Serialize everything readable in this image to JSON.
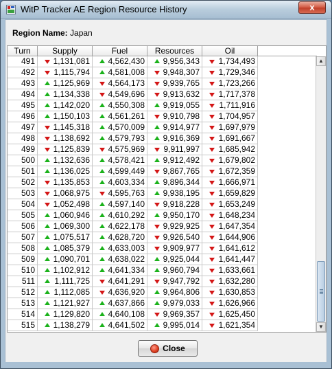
{
  "window": {
    "title": "WitP Tracker AE Region Resource History",
    "close_glyph": "x"
  },
  "region": {
    "label": "Region Name:",
    "value": "Japan"
  },
  "table": {
    "columns": [
      "Turn",
      "Supply",
      "Fuel",
      "Resources",
      "Oil"
    ],
    "rows": [
      {
        "turn": "491",
        "supply": "1,131,081",
        "supply_dir": "down",
        "fuel": "4,562,430",
        "fuel_dir": "up",
        "resources": "9,956,343",
        "resources_dir": "up",
        "oil": "1,734,493",
        "oil_dir": "down"
      },
      {
        "turn": "492",
        "supply": "1,115,794",
        "supply_dir": "down",
        "fuel": "4,581,008",
        "fuel_dir": "up",
        "resources": "9,948,307",
        "resources_dir": "down",
        "oil": "1,729,346",
        "oil_dir": "down"
      },
      {
        "turn": "493",
        "supply": "1,125,969",
        "supply_dir": "up",
        "fuel": "4,564,173",
        "fuel_dir": "down",
        "resources": "9,939,765",
        "resources_dir": "down",
        "oil": "1,723,266",
        "oil_dir": "down"
      },
      {
        "turn": "494",
        "supply": "1,134,338",
        "supply_dir": "up",
        "fuel": "4,549,696",
        "fuel_dir": "down",
        "resources": "9,913,632",
        "resources_dir": "down",
        "oil": "1,717,378",
        "oil_dir": "down"
      },
      {
        "turn": "495",
        "supply": "1,142,020",
        "supply_dir": "up",
        "fuel": "4,550,308",
        "fuel_dir": "up",
        "resources": "9,919,055",
        "resources_dir": "up",
        "oil": "1,711,916",
        "oil_dir": "down"
      },
      {
        "turn": "496",
        "supply": "1,150,103",
        "supply_dir": "up",
        "fuel": "4,561,261",
        "fuel_dir": "up",
        "resources": "9,910,798",
        "resources_dir": "down",
        "oil": "1,704,957",
        "oil_dir": "down"
      },
      {
        "turn": "497",
        "supply": "1,145,318",
        "supply_dir": "down",
        "fuel": "4,570,009",
        "fuel_dir": "up",
        "resources": "9,914,977",
        "resources_dir": "up",
        "oil": "1,697,979",
        "oil_dir": "down"
      },
      {
        "turn": "498",
        "supply": "1,138,692",
        "supply_dir": "down",
        "fuel": "4,579,793",
        "fuel_dir": "up",
        "resources": "9,916,369",
        "resources_dir": "up",
        "oil": "1,691,667",
        "oil_dir": "down"
      },
      {
        "turn": "499",
        "supply": "1,125,839",
        "supply_dir": "down",
        "fuel": "4,575,969",
        "fuel_dir": "down",
        "resources": "9,911,997",
        "resources_dir": "down",
        "oil": "1,685,942",
        "oil_dir": "down"
      },
      {
        "turn": "500",
        "supply": "1,132,636",
        "supply_dir": "up",
        "fuel": "4,578,421",
        "fuel_dir": "up",
        "resources": "9,912,492",
        "resources_dir": "up",
        "oil": "1,679,802",
        "oil_dir": "down"
      },
      {
        "turn": "501",
        "supply": "1,136,025",
        "supply_dir": "up",
        "fuel": "4,599,449",
        "fuel_dir": "up",
        "resources": "9,867,765",
        "resources_dir": "down",
        "oil": "1,672,359",
        "oil_dir": "down"
      },
      {
        "turn": "502",
        "supply": "1,135,853",
        "supply_dir": "down",
        "fuel": "4,603,334",
        "fuel_dir": "up",
        "resources": "9,896,344",
        "resources_dir": "up",
        "oil": "1,666,971",
        "oil_dir": "down"
      },
      {
        "turn": "503",
        "supply": "1,068,975",
        "supply_dir": "down",
        "fuel": "4,595,763",
        "fuel_dir": "down",
        "resources": "9,938,195",
        "resources_dir": "up",
        "oil": "1,659,829",
        "oil_dir": "down"
      },
      {
        "turn": "504",
        "supply": "1,052,498",
        "supply_dir": "down",
        "fuel": "4,597,140",
        "fuel_dir": "up",
        "resources": "9,918,228",
        "resources_dir": "down",
        "oil": "1,653,249",
        "oil_dir": "down"
      },
      {
        "turn": "505",
        "supply": "1,060,946",
        "supply_dir": "up",
        "fuel": "4,610,292",
        "fuel_dir": "up",
        "resources": "9,950,170",
        "resources_dir": "up",
        "oil": "1,648,234",
        "oil_dir": "down"
      },
      {
        "turn": "506",
        "supply": "1,069,300",
        "supply_dir": "up",
        "fuel": "4,622,178",
        "fuel_dir": "up",
        "resources": "9,929,925",
        "resources_dir": "down",
        "oil": "1,647,354",
        "oil_dir": "down"
      },
      {
        "turn": "507",
        "supply": "1,075,517",
        "supply_dir": "up",
        "fuel": "4,628,720",
        "fuel_dir": "up",
        "resources": "9,926,540",
        "resources_dir": "down",
        "oil": "1,644,906",
        "oil_dir": "down"
      },
      {
        "turn": "508",
        "supply": "1,085,379",
        "supply_dir": "up",
        "fuel": "4,633,003",
        "fuel_dir": "up",
        "resources": "9,909,977",
        "resources_dir": "down",
        "oil": "1,641,612",
        "oil_dir": "down"
      },
      {
        "turn": "509",
        "supply": "1,090,701",
        "supply_dir": "up",
        "fuel": "4,638,022",
        "fuel_dir": "up",
        "resources": "9,925,044",
        "resources_dir": "up",
        "oil": "1,641,447",
        "oil_dir": "down"
      },
      {
        "turn": "510",
        "supply": "1,102,912",
        "supply_dir": "up",
        "fuel": "4,641,334",
        "fuel_dir": "up",
        "resources": "9,960,794",
        "resources_dir": "up",
        "oil": "1,633,661",
        "oil_dir": "down"
      },
      {
        "turn": "511",
        "supply": "1,111,725",
        "supply_dir": "up",
        "fuel": "4,641,291",
        "fuel_dir": "down",
        "resources": "9,947,792",
        "resources_dir": "down",
        "oil": "1,632,280",
        "oil_dir": "down"
      },
      {
        "turn": "512",
        "supply": "1,112,085",
        "supply_dir": "up",
        "fuel": "4,636,920",
        "fuel_dir": "down",
        "resources": "9,964,806",
        "resources_dir": "up",
        "oil": "1,630,853",
        "oil_dir": "down"
      },
      {
        "turn": "513",
        "supply": "1,121,927",
        "supply_dir": "up",
        "fuel": "4,637,866",
        "fuel_dir": "up",
        "resources": "9,979,033",
        "resources_dir": "up",
        "oil": "1,626,966",
        "oil_dir": "down"
      },
      {
        "turn": "514",
        "supply": "1,129,820",
        "supply_dir": "up",
        "fuel": "4,640,108",
        "fuel_dir": "up",
        "resources": "9,969,357",
        "resources_dir": "down",
        "oil": "1,625,450",
        "oil_dir": "down"
      },
      {
        "turn": "515",
        "supply": "1,138,279",
        "supply_dir": "up",
        "fuel": "4,641,502",
        "fuel_dir": "up",
        "resources": "9,995,014",
        "resources_dir": "up",
        "oil": "1,621,354",
        "oil_dir": "down"
      }
    ]
  },
  "scrollbar": {
    "up_glyph": "▲",
    "down_glyph": "▼"
  },
  "footer": {
    "close_label": "Close"
  },
  "colors": {
    "up": "#1bb21b",
    "down": "#d41616"
  }
}
